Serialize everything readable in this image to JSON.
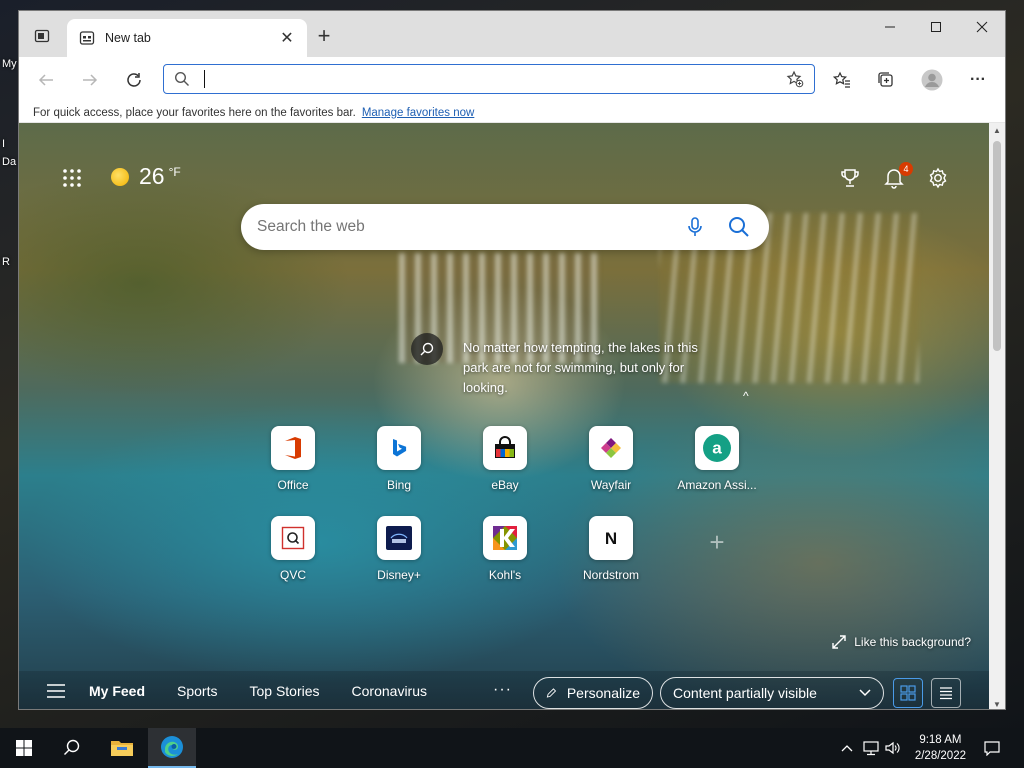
{
  "desktop": {
    "fragments": [
      "My",
      "I",
      "Da",
      "R"
    ]
  },
  "browser": {
    "tab": {
      "title": "New tab",
      "close": "✕"
    },
    "new_tab_symbol": "+",
    "address": {
      "value": "",
      "placeholder": ""
    },
    "favorites_bar": {
      "message": "For quick access, place your favorites here on the favorites bar.",
      "link": "Manage favorites now"
    },
    "more_symbol": "···"
  },
  "ntp": {
    "weather": {
      "temp": "26",
      "unit": "°F"
    },
    "notifications_count": "4",
    "search": {
      "placeholder": "Search the web"
    },
    "background_caption": "No matter how tempting, the lakes in this park are not for swimming, but only for looking.",
    "collapse_symbol": "^",
    "quick_links": [
      {
        "label": "Office",
        "icon": "office-icon"
      },
      {
        "label": "Bing",
        "icon": "bing-icon"
      },
      {
        "label": "eBay",
        "icon": "ebay-icon"
      },
      {
        "label": "Wayfair",
        "icon": "wayfair-icon"
      },
      {
        "label": "Amazon Assi...",
        "icon": "amazon-icon"
      },
      {
        "label": "QVC",
        "icon": "qvc-icon"
      },
      {
        "label": "Disney+",
        "icon": "disney-plus-icon"
      },
      {
        "label": "Kohl's",
        "icon": "kohls-icon"
      },
      {
        "label": "Nordstrom",
        "icon": "nordstrom-icon"
      }
    ],
    "add_quick_link_symbol": "+",
    "like_background": "Like this background?",
    "feed": {
      "tabs": [
        "My Feed",
        "Sports",
        "Top Stories",
        "Coronavirus"
      ],
      "more": "···",
      "personalize": "Personalize",
      "content_visibility": "Content partially visible"
    }
  },
  "taskbar": {
    "time": "9:18 AM",
    "date": "2/28/2022"
  },
  "colors": {
    "accent": "#2f6fd1",
    "notification_badge": "#d83b01",
    "link": "#1e5fb3"
  }
}
